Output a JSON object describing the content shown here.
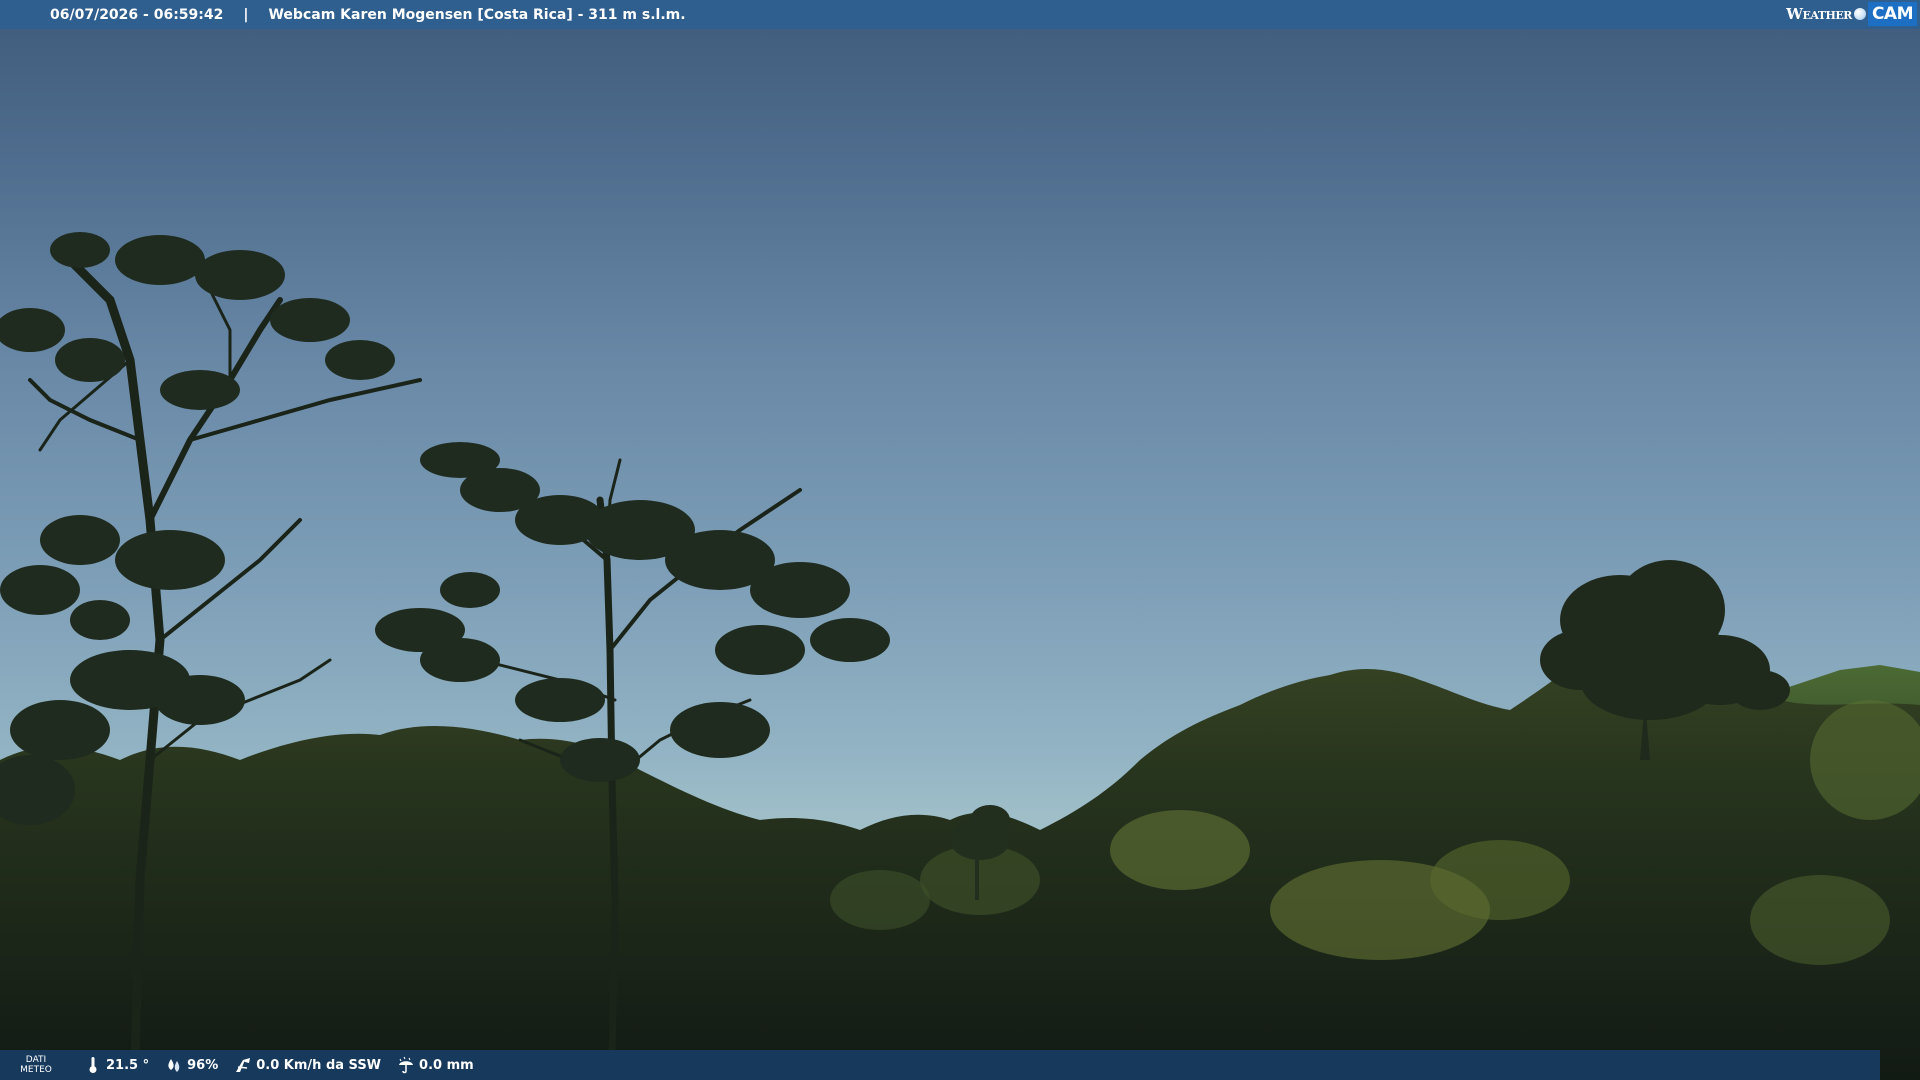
{
  "header": {
    "timestamp": "06/07/2026 - 06:59:42",
    "separator": "|",
    "title": "Webcam Karen Mogensen [Costa Rica]  - 311 m s.l.m.",
    "logo": {
      "weather_text": "Weather",
      "cam_text": "CAM",
      "brand_color": "#1d6fc4"
    }
  },
  "scene": {
    "sky_colors": [
      "#3f5b7c",
      "#a8c6cc"
    ],
    "foliage_color": "#1c2a1e"
  },
  "weather_bar": {
    "label_line1": "DATI",
    "label_line2": "METEO",
    "temperature": {
      "icon": "thermometer-icon",
      "value": "21.5 °"
    },
    "humidity": {
      "icon": "humidity-drops-icon",
      "value": "96%"
    },
    "wind": {
      "icon": "wind-icon",
      "value": "0.0 Km/h da SSW"
    },
    "rain": {
      "icon": "rain-umbrella-icon",
      "value": "0.0 mm"
    }
  }
}
